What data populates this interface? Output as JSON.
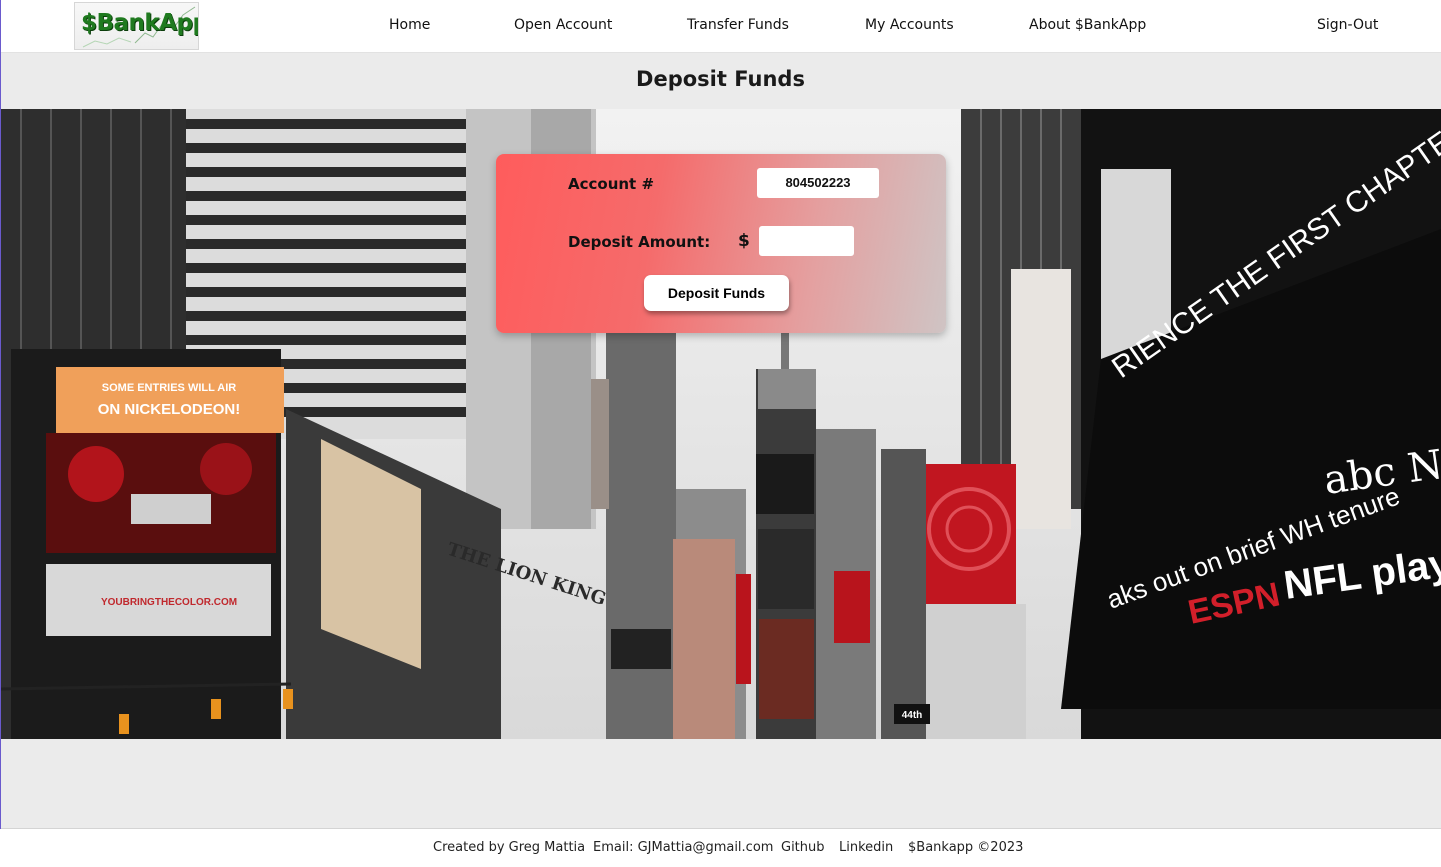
{
  "nav": {
    "logo_text": "$BankApp",
    "links": [
      {
        "label": "Home"
      },
      {
        "label": "Open Account"
      },
      {
        "label": "Transfer Funds"
      },
      {
        "label": "My Accounts"
      },
      {
        "label": "About $BankApp"
      },
      {
        "label": "Sign-Out"
      }
    ]
  },
  "page": {
    "title": "Deposit Funds"
  },
  "form": {
    "account_label": "Account #",
    "account_number": "804502223",
    "amount_label": "Deposit Amount:",
    "currency_symbol": "$",
    "amount_value": "",
    "submit_label": "Deposit Funds",
    "accent_color": "#ff5c5c"
  },
  "hero": {
    "billboards": {
      "nick_line1": "SOME ENTRIES WILL AIR",
      "nick_line2": "ON NICKELODEON!",
      "color_ad": "YOUBRINGTHECOLOR.COM",
      "lion_king": "THE LION KING",
      "ticker1": "aks out on brief WH tenure",
      "ticker2": "NFL play",
      "abc": "abc NE",
      "espn": "ESPN",
      "experience": "RIENCE THE FIRST CHAPTER EAR",
      "street": "44th"
    }
  },
  "footer": {
    "created_by": "Created by Greg Mattia",
    "email": "Email: GJMattia@gmail.com",
    "github": "Github",
    "linkedin": "Linkedin",
    "copyright": "$Bankapp ©2023"
  }
}
